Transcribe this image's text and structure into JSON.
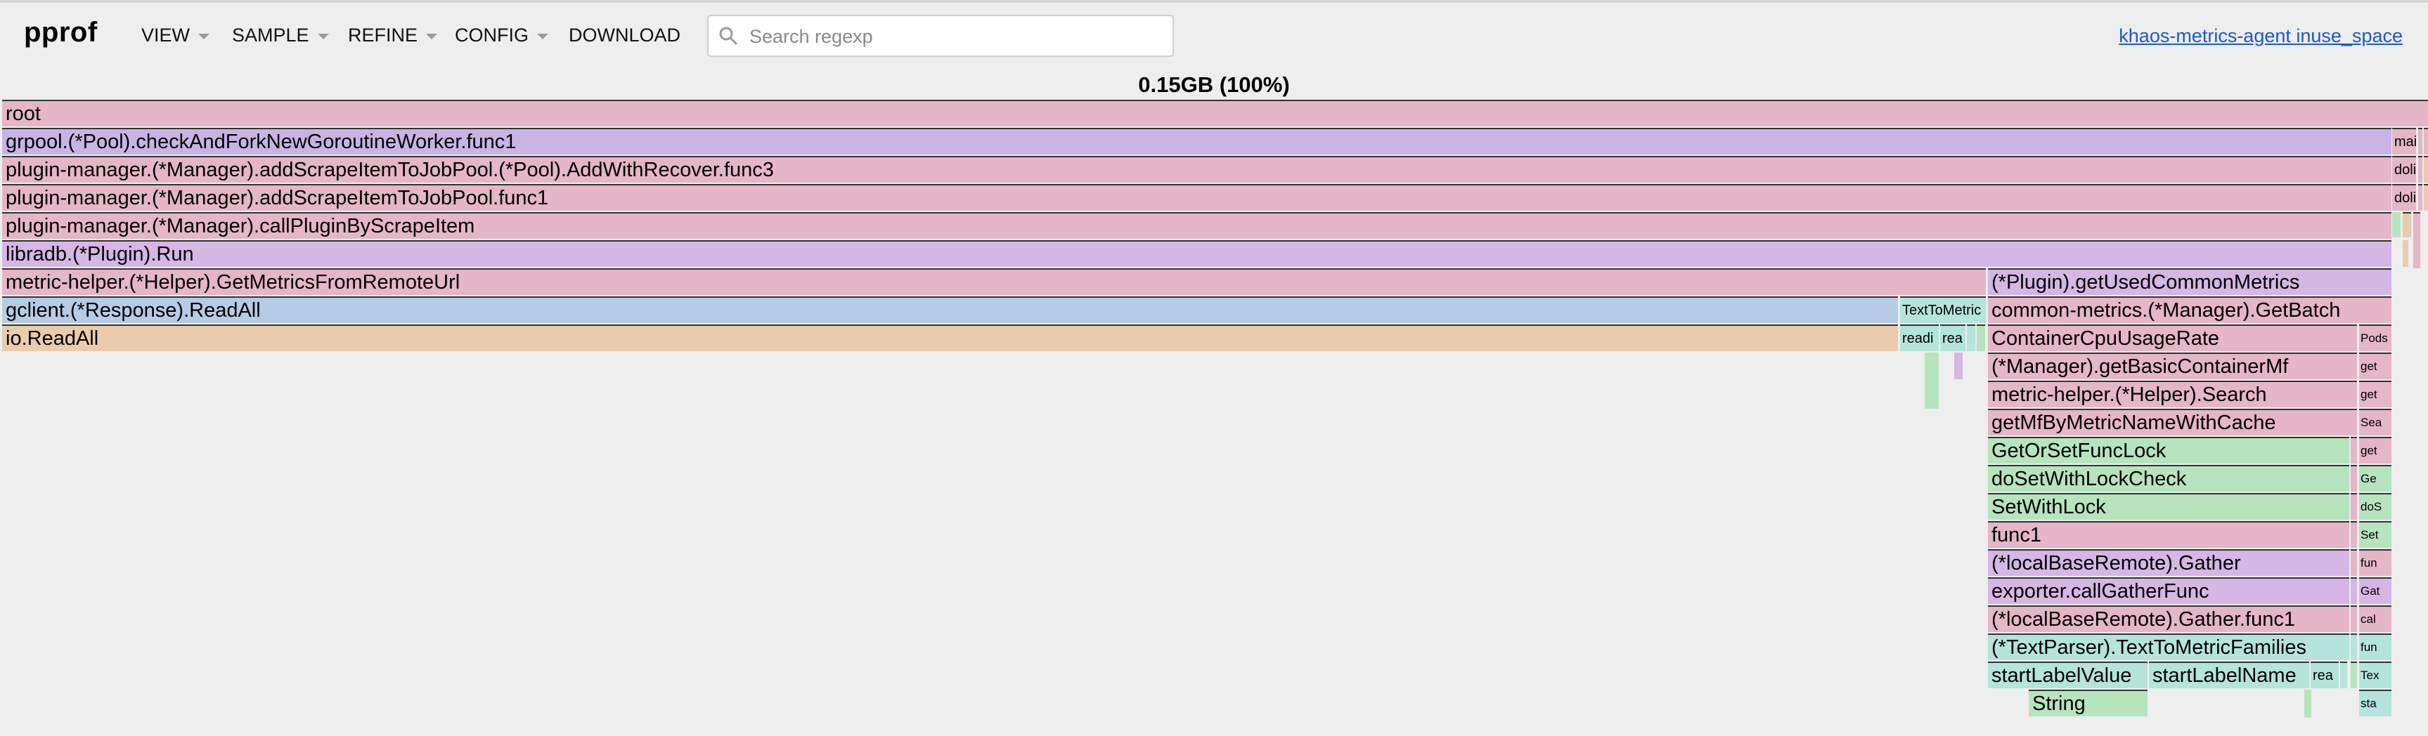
{
  "app": {
    "logo": "pprof",
    "menus": [
      "VIEW",
      "SAMPLE",
      "REFINE",
      "CONFIG",
      "DOWNLOAD"
    ],
    "search_placeholder": "Search regexp",
    "profile_link": "khaos-metrics-agent inuse_space",
    "total": "0.15GB (100%)"
  },
  "colors": {
    "pink": "#e4b6c7",
    "purple": "#c7b4e4",
    "lavender": "#d5b6e4",
    "blue": "#b6cbe4",
    "tan": "#e9cbad",
    "green": "#b6e4bd",
    "teal": "#b4e4dc"
  },
  "frames": {
    "root": "root",
    "pool_worker": "grpool.(*Pool).checkAndForkNewGoroutineWorker.func1",
    "add_with_recover": "plugin-manager.(*Manager).addScrapeItemToJobPool.(*Pool).AddWithRecover.func3",
    "add_scrape_func1": "plugin-manager.(*Manager).addScrapeItemToJobPool.func1",
    "call_plugin": "plugin-manager.(*Manager).callPluginByScrapeItem",
    "plugin_run": "libradb.(*Plugin).Run",
    "get_metrics_remote": "metric-helper.(*Helper).GetMetricsFromRemoteUrl",
    "get_used_common": "(*Plugin).getUsedCommonMetrics",
    "readall_response": "gclient.(*Response).ReadAll",
    "text_to_metric": "TextToMetric",
    "get_batch": "common-metrics.(*Manager).GetBatch",
    "io_readall": "io.ReadAll",
    "readi": "readi",
    "rea": "rea",
    "container_cpu": "ContainerCpuUsageRate",
    "pods": "Pods",
    "get_basic_container": "(*Manager).getBasicContainerMf",
    "get": "get",
    "helper_search": "metric-helper.(*Helper).Search",
    "get_mf_cache": "getMfByMetricNameWithCache",
    "se": "Sea",
    "get_or_set": "GetOrSetFuncLock",
    "do_set_lock": "doSetWithLockCheck",
    "ge": "Ge",
    "set_with_lock": "SetWithLock",
    "dos": "doS",
    "func1": "func1",
    "set": "Set",
    "local_gather": "(*localBaseRemote).Gather",
    "fun": "fun",
    "call_gather": "exporter.callGatherFunc",
    "gat": "Gat",
    "local_gather_func1": "(*localBaseRemote).Gather.func1",
    "cal": "cal",
    "text_parser": "(*TextParser).TextToMetricFamilies",
    "start_label_value": "startLabelValue",
    "start_label_name": "startLabelName",
    "tex": "Tex",
    "string": "String",
    "sta": "sta",
    "mai": "mai",
    "doli": "doli"
  }
}
